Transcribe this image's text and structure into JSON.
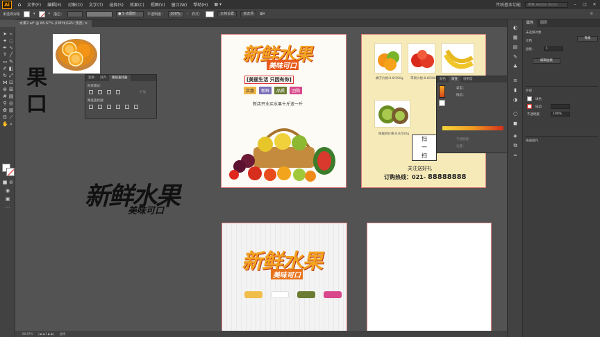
{
  "app": {
    "logo": "Ai",
    "menu": [
      "文件(F)",
      "编辑(E)",
      "对象(O)",
      "文字(T)",
      "选择(S)",
      "效果(C)",
      "视图(V)",
      "窗口(W)",
      "帮助(H)"
    ],
    "workspace": "传统基本功能",
    "search_placeholder": "搜索 Adobe Stock"
  },
  "control_bar": {
    "selection": "未选择对象",
    "stroke_label": "描边：",
    "brush": "5 点圆形",
    "opacity_label": "不透明度：",
    "opacity": "100%",
    "style_label": "样式：",
    "doc_setup": "文档设置",
    "preferences": "首选项"
  },
  "document": {
    "tab": "水果2.ai* @ 66.67% (CMYK/GPU 预览)",
    "zoom": "66.67%",
    "status_tool": "选择"
  },
  "canvas": {
    "glyph_top": "果",
    "glyph_bottom": "口",
    "logo_main": "新鲜水果",
    "logo_sub": "美味可口"
  },
  "poster1": {
    "title": "新鲜水果",
    "subtitle": "美味可口",
    "slogan": "[美丽生活 只因有你]",
    "tags": [
      {
        "label": "实惠",
        "color": "#f0b84a"
      },
      {
        "label": "新鲜",
        "color": "#7b6fb8"
      },
      {
        "label": "品质",
        "color": "#6a7b32"
      },
      {
        "label": "团购",
        "color": "#d9478c"
      }
    ],
    "promo": "新店开业买水果十斤送一斤"
  },
  "poster2": {
    "fruits": [
      {
        "caption": "橘子价格:8.8/500g"
      },
      {
        "caption": "苹果价格:8.8/500g"
      },
      {
        "caption": "香蕉价格:8.8/500g"
      },
      {
        "caption": "猕猴桃价格:8.8/500g"
      }
    ],
    "qr_text": [
      "扫",
      "一",
      "扫"
    ],
    "follow": "关注送好礼",
    "hotline_label": "订购热线：",
    "hotline_area": "021-",
    "hotline_number": "88888888"
  },
  "poster3": {
    "title": "新鲜水果",
    "subtitle": "美味可口",
    "pills": [
      "#f0bd4a",
      "#ffffff",
      "#6b7b32",
      "#d9478c"
    ]
  },
  "panel_left": {
    "tabs": [
      "变换",
      "对齐",
      "路径查找器"
    ],
    "shape_modes": "形状模式：",
    "pathfinders": "路径查找器：",
    "expand": "扩展"
  },
  "panel_color": {
    "tabs": [
      "颜色",
      "渐变",
      "透明度"
    ],
    "type_label": "类型：",
    "stroke_label": "描边：",
    "opacity_label": "不透明度：",
    "location_label": "位置："
  },
  "properties": {
    "tabs": [
      "属性",
      "图层"
    ],
    "no_selection": "未选择对象",
    "doc_label": "文档",
    "unit": "像素",
    "artboard_label": "画板：",
    "artboard_value": "1",
    "edit_artboards": "编辑画板",
    "appearance": "外观",
    "fill": "填色",
    "stroke": "描边",
    "opacity": "不透明度",
    "opacity_value": "100%",
    "quick_actions": "快速操作"
  }
}
